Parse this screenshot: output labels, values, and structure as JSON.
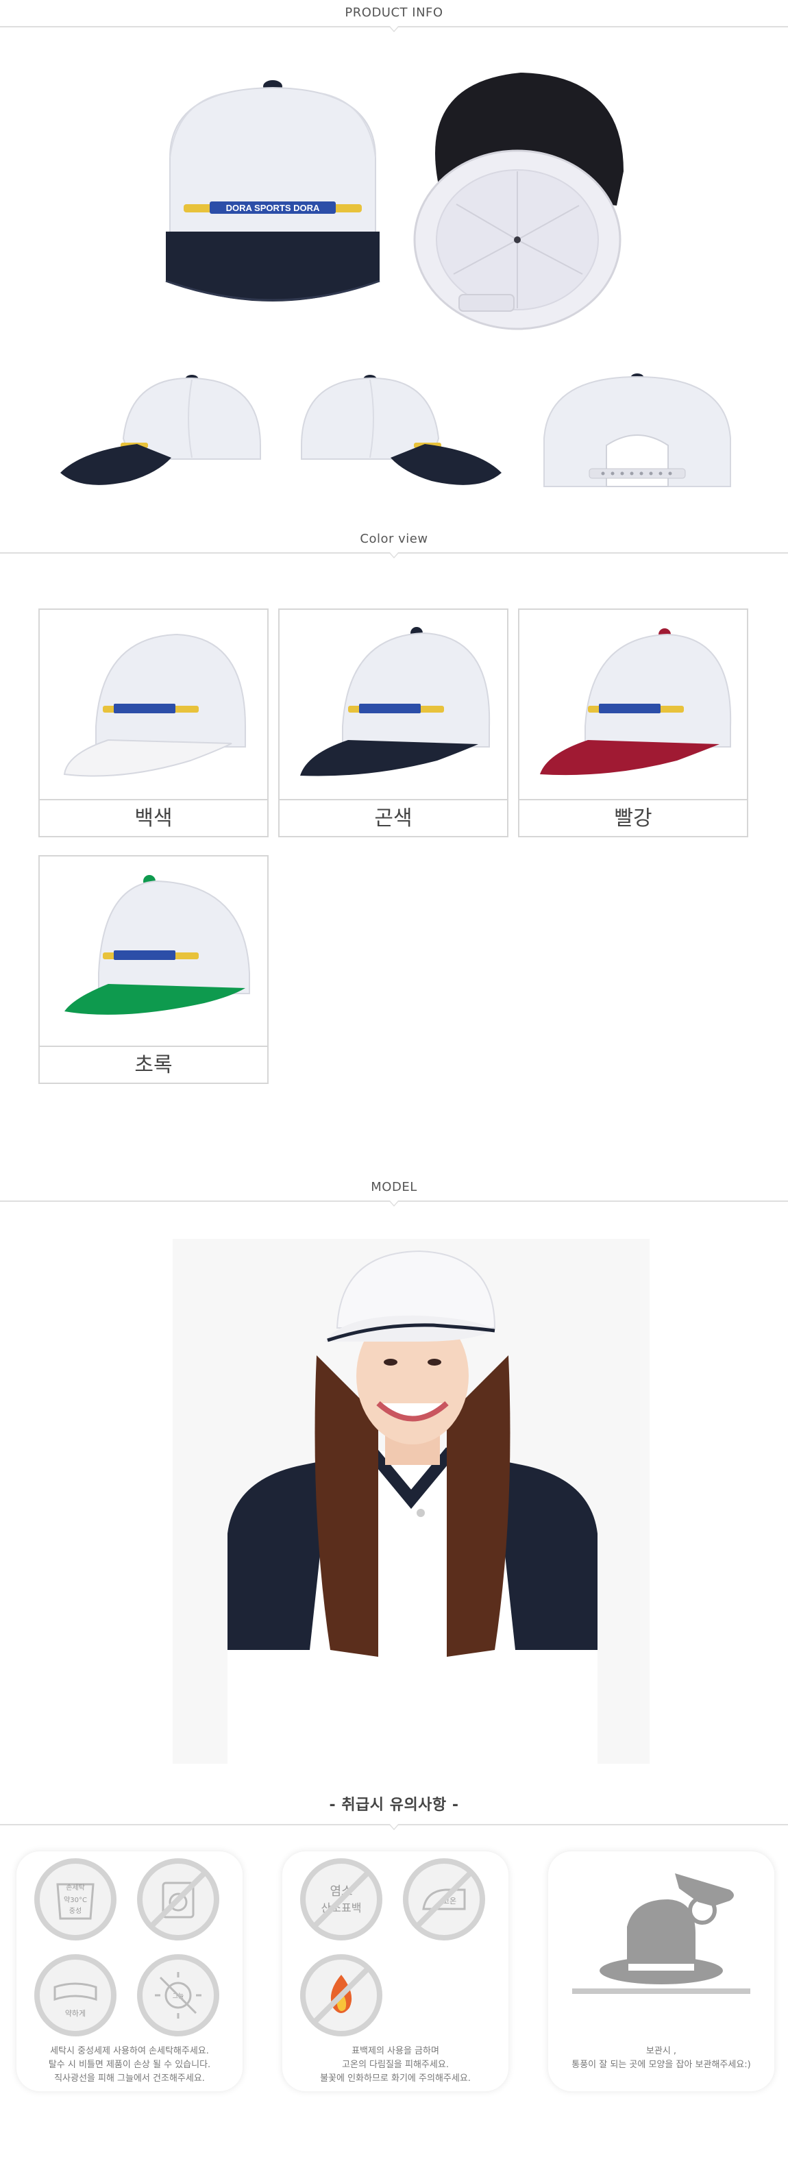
{
  "sections": {
    "product_info": "PRODUCT INFO",
    "color_view": "Color view",
    "model": "MODEL",
    "care": "-  취급시 유의사항  -"
  },
  "product": {
    "embroidery_text": "DORA SPORTS DORA"
  },
  "colors": [
    {
      "label": "백색",
      "brim": "#f4f4f6",
      "button": "#ffffff"
    },
    {
      "label": "곤색",
      "brim": "#1d2436",
      "button": "#1d2436"
    },
    {
      "label": "빨강",
      "brim": "#a01a33",
      "button": "#a01a33"
    },
    {
      "label": "초록",
      "brim": "#0e9a4e",
      "button": "#0e9a4e"
    }
  ],
  "care": {
    "cards": [
      {
        "icons": [
          {
            "name": "hand-wash-icon",
            "text_lines": [
              "손세탁",
              "약30°C",
              "중성"
            ]
          },
          {
            "name": "no-dry-clean-icon",
            "text_lines": []
          },
          {
            "name": "wring-gently-icon",
            "text_lines": [
              "약하게"
            ]
          },
          {
            "name": "no-sunlight-icon",
            "text_lines": [
              "그늘"
            ]
          }
        ],
        "notes": [
          "세탁시 중성세제 사용하여 손세탁해주세요.",
          "탈수 시 비틀면 제품이 손상 될 수 있습니다.",
          "직사광선을 피해 그늘에서 건조해주세요."
        ]
      },
      {
        "icons": [
          {
            "name": "no-bleach-icon",
            "text_lines": [
              "염소",
              "산소표백"
            ]
          },
          {
            "name": "iron-high-icon",
            "text_lines": [
              "고온"
            ]
          },
          {
            "name": "no-fire-icon",
            "text_lines": []
          }
        ],
        "notes": [
          "표백제의 사용을 금하며",
          "고온의 다림질을 피해주세요.",
          "불꽃에 인화하므로 화기에 주의해주세요."
        ]
      },
      {
        "icons": [
          {
            "name": "hat-storage-icon",
            "text_lines": []
          }
        ],
        "notes": [
          "보관시 ,",
          "통풍이 잘 되는 곳에 모양을 잡아 보관해주세요:)"
        ]
      }
    ]
  },
  "palette": {
    "navy": "#1d2436",
    "hat_white": "#eceef4",
    "rule": "#dedede"
  }
}
